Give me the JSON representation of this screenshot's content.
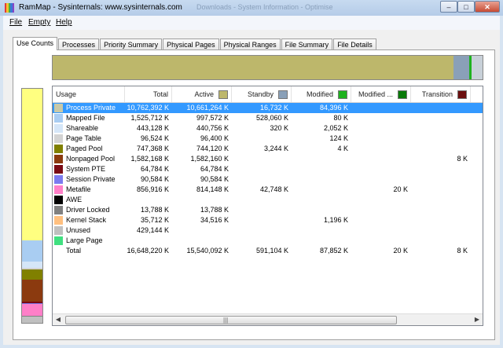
{
  "window": {
    "title": "RamMap - Sysinternals: www.sysinternals.com",
    "ghost_title": "Downloads - System Information - Optimise",
    "controls": {
      "minimize": "–",
      "maximize": "□",
      "close": "✕"
    },
    "icon_colors": [
      "#e23b3b",
      "#f2c22d",
      "#43b04a",
      "#3a78d8",
      "#8a45c4"
    ]
  },
  "menu": [
    {
      "label": "File"
    },
    {
      "label": "Empty"
    },
    {
      "label": "Help"
    }
  ],
  "tabs": [
    {
      "label": "Use Counts",
      "active": true
    },
    {
      "label": "Processes"
    },
    {
      "label": "Priority Summary"
    },
    {
      "label": "Physical Pages"
    },
    {
      "label": "Physical Ranges"
    },
    {
      "label": "File Summary"
    },
    {
      "label": "File Details"
    }
  ],
  "columns": {
    "usage": "Usage",
    "total": "Total",
    "active": "Active",
    "standby": "Standby",
    "modified": "Modified",
    "modified_no_write": "Modified ...",
    "transition": "Transition"
  },
  "column_colors": {
    "active": "#bdb76b",
    "standby": "#8aa0b8",
    "modified": "#1fb21f",
    "modified_no_write": "#0a7a0a",
    "transition": "#6b0f0f"
  },
  "rows": [
    {
      "usage": "Process Private",
      "color": "#c9c9a8",
      "total": "10,762,392 K",
      "active": "10,661,264 K",
      "standby": "16,732 K",
      "modified": "84,396 K",
      "modified_no_write": "",
      "transition": "",
      "selected": true
    },
    {
      "usage": "Mapped File",
      "color": "#a9cdf2",
      "total": "1,525,712 K",
      "active": "997,572 K",
      "standby": "528,060 K",
      "modified": "80 K",
      "modified_no_write": "",
      "transition": ""
    },
    {
      "usage": "Shareable",
      "color": "#d5e6f8",
      "total": "443,128 K",
      "active": "440,756 K",
      "standby": "320 K",
      "modified": "2,052 K",
      "modified_no_write": "",
      "transition": ""
    },
    {
      "usage": "Page Table",
      "color": "#d3d3d3",
      "total": "96,524 K",
      "active": "96,400 K",
      "standby": "",
      "modified": "124 K",
      "modified_no_write": "",
      "transition": ""
    },
    {
      "usage": "Paged Pool",
      "color": "#808000",
      "total": "747,368 K",
      "active": "744,120 K",
      "standby": "3,244 K",
      "modified": "4 K",
      "modified_no_write": "",
      "transition": ""
    },
    {
      "usage": "Nonpaged Pool",
      "color": "#8b3a0f",
      "total": "1,582,168 K",
      "active": "1,582,160 K",
      "standby": "",
      "modified": "",
      "modified_no_write": "",
      "transition": "8 K"
    },
    {
      "usage": "System PTE",
      "color": "#7a0a14",
      "total": "64,784 K",
      "active": "64,784 K",
      "standby": "",
      "modified": "",
      "modified_no_write": "",
      "transition": ""
    },
    {
      "usage": "Session Private",
      "color": "#7b7bf0",
      "total": "90,584 K",
      "active": "90,584 K",
      "standby": "",
      "modified": "",
      "modified_no_write": "",
      "transition": ""
    },
    {
      "usage": "Metafile",
      "color": "#ff7fc8",
      "total": "856,916 K",
      "active": "814,148 K",
      "standby": "42,748 K",
      "modified": "",
      "modified_no_write": "20 K",
      "transition": ""
    },
    {
      "usage": "AWE",
      "color": "#000000",
      "total": "",
      "active": "",
      "standby": "",
      "modified": "",
      "modified_no_write": "",
      "transition": ""
    },
    {
      "usage": "Driver Locked",
      "color": "#808080",
      "total": "13,788 K",
      "active": "13,788 K",
      "standby": "",
      "modified": "",
      "modified_no_write": "",
      "transition": ""
    },
    {
      "usage": "Kernel Stack",
      "color": "#ffc080",
      "total": "35,712 K",
      "active": "34,516 K",
      "standby": "",
      "modified": "1,196 K",
      "modified_no_write": "",
      "transition": ""
    },
    {
      "usage": "Unused",
      "color": "#c0c0c0",
      "total": "429,144 K",
      "active": "",
      "standby": "",
      "modified": "",
      "modified_no_write": "",
      "transition": ""
    },
    {
      "usage": "Large Page",
      "color": "#40e080",
      "total": "",
      "active": "",
      "standby": "",
      "modified": "",
      "modified_no_write": "",
      "transition": ""
    },
    {
      "usage": "Total",
      "color": "",
      "total": "16,648,220 K",
      "active": "15,540,092 K",
      "standby": "591,104 K",
      "modified": "87,852 K",
      "modified_no_write": "20 K",
      "transition": "8 K"
    }
  ],
  "usage_bar": [
    {
      "name": "Process Private",
      "color": "#ffff80",
      "fraction": 0.646
    },
    {
      "name": "Mapped File",
      "color": "#a9cdf2",
      "fraction": 0.092
    },
    {
      "name": "Shareable",
      "color": "#d5e6f8",
      "fraction": 0.027
    },
    {
      "name": "Page Table",
      "color": "#d3d3d3",
      "fraction": 0.006
    },
    {
      "name": "Paged Pool",
      "color": "#808000",
      "fraction": 0.045
    },
    {
      "name": "Nonpaged Pool",
      "color": "#8b3a0f",
      "fraction": 0.095
    },
    {
      "name": "System PTE",
      "color": "#7a0a14",
      "fraction": 0.004
    },
    {
      "name": "Session Private",
      "color": "#7b7bf0",
      "fraction": 0.005
    },
    {
      "name": "Metafile",
      "color": "#ff7fc8",
      "fraction": 0.051
    },
    {
      "name": "Driver Locked",
      "color": "#808080",
      "fraction": 0.001
    },
    {
      "name": "Kernel Stack",
      "color": "#ffc080",
      "fraction": 0.002
    },
    {
      "name": "Unused",
      "color": "#c0c0c0",
      "fraction": 0.026
    }
  ],
  "state_bar": [
    {
      "name": "Active",
      "color": "#bdb76b",
      "fraction": 0.933
    },
    {
      "name": "Standby",
      "color": "#8aa0b8",
      "fraction": 0.0355
    },
    {
      "name": "Modified",
      "color": "#1fb21f",
      "fraction": 0.0053
    },
    {
      "name": "Unused",
      "color": "#c8d0d8",
      "fraction": 0.0262
    }
  ]
}
